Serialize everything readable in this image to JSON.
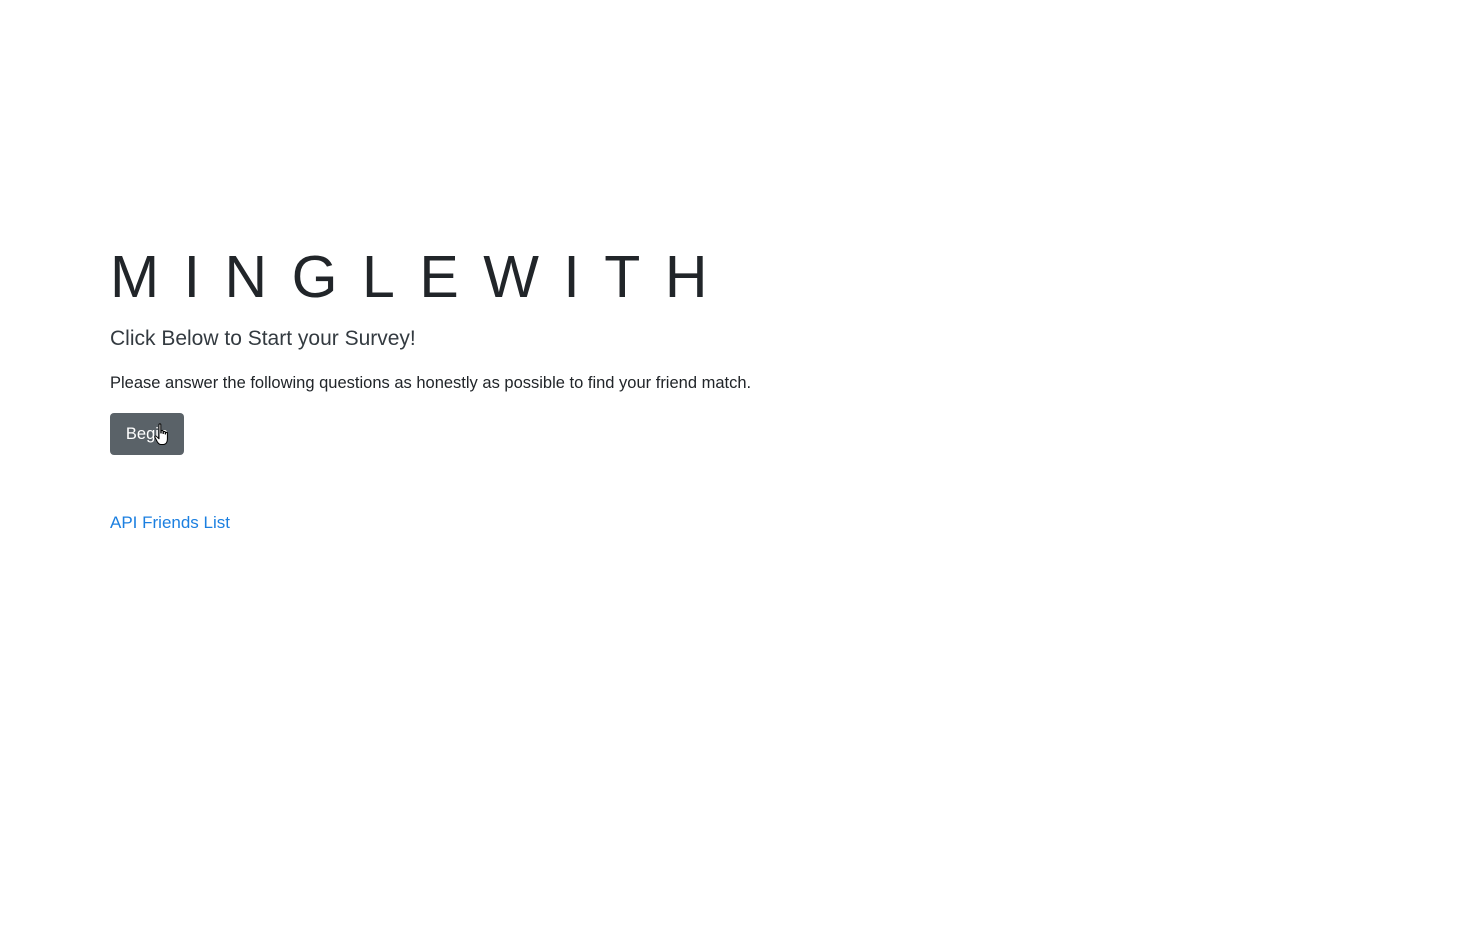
{
  "hero": {
    "title": "MINGLEWITH",
    "subtitle": "Click Below to Start your Survey!",
    "description": "Please answer the following questions as honestly as possible to find your friend match.",
    "begin_label": "Begin"
  },
  "links": {
    "api_friends_label": "API Friends List"
  },
  "icons": {
    "cursor": "hand-pointer-icon"
  },
  "colors": {
    "button_bg": "#5a6268",
    "link": "#1b7fe0",
    "text": "#212529"
  }
}
